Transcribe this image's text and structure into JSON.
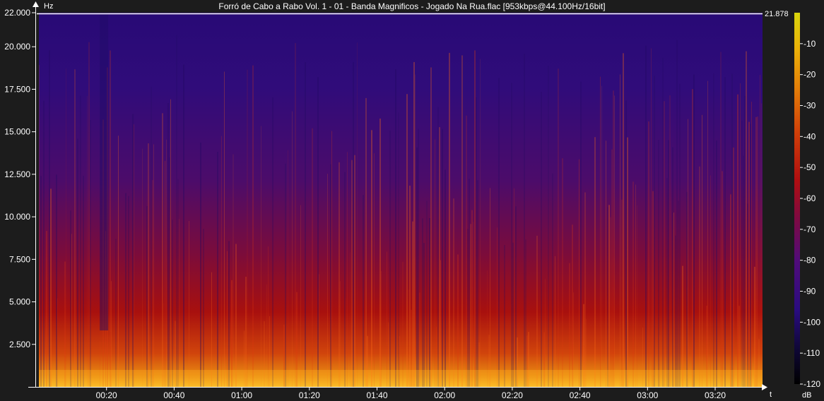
{
  "title": "Forró de Cabo a Rabo Vol. 1  -  01 - Banda Magnificos - Jogado Na Rua.flac [953kbps@44.100Hz/16bit]",
  "chart_data": {
    "type": "heatmap",
    "title": "Forró de Cabo a Rabo Vol. 1  -  01 - Banda Magnificos - Jogado Na Rua.flac [953kbps@44.100Hz/16bit]",
    "y_axis": {
      "label": "Hz",
      "range": [
        0,
        22000
      ],
      "ticks": [
        "2.500",
        "5.000",
        "7.500",
        "10.000",
        "12.500",
        "15.000",
        "17.500",
        "20.000",
        "22.000"
      ],
      "tick_values": [
        2500,
        5000,
        7500,
        10000,
        12500,
        15000,
        17500,
        20000,
        22000
      ]
    },
    "x_axis": {
      "label": "t",
      "range_seconds": [
        0,
        214
      ],
      "ticks": [
        "00:20",
        "00:40",
        "01:00",
        "01:20",
        "01:40",
        "02:00",
        "02:20",
        "02:40",
        "03:00",
        "03:20"
      ],
      "tick_values": [
        20,
        40,
        60,
        80,
        100,
        120,
        140,
        160,
        180,
        200
      ]
    },
    "cutoff": {
      "label": "21.878",
      "value_hz": 21878
    },
    "colorbar": {
      "label": "dB",
      "range": [
        -120,
        0
      ],
      "ticks": [
        "-10",
        "-20",
        "-30",
        "-40",
        "-50",
        "-60",
        "-70",
        "-80",
        "-90",
        "-100",
        "-110",
        "-120"
      ],
      "tick_values": [
        -10,
        -20,
        -30,
        -40,
        -50,
        -60,
        -70,
        -80,
        -90,
        -100,
        -110,
        -120
      ],
      "colors": [
        "#000000",
        "#1a0a5e",
        "#3c0c8c",
        "#5a0c6e",
        "#8a0a2c",
        "#b8100c",
        "#d8400a",
        "#e8780a",
        "#f0b00a",
        "#d4d00c"
      ]
    },
    "grid": false
  }
}
